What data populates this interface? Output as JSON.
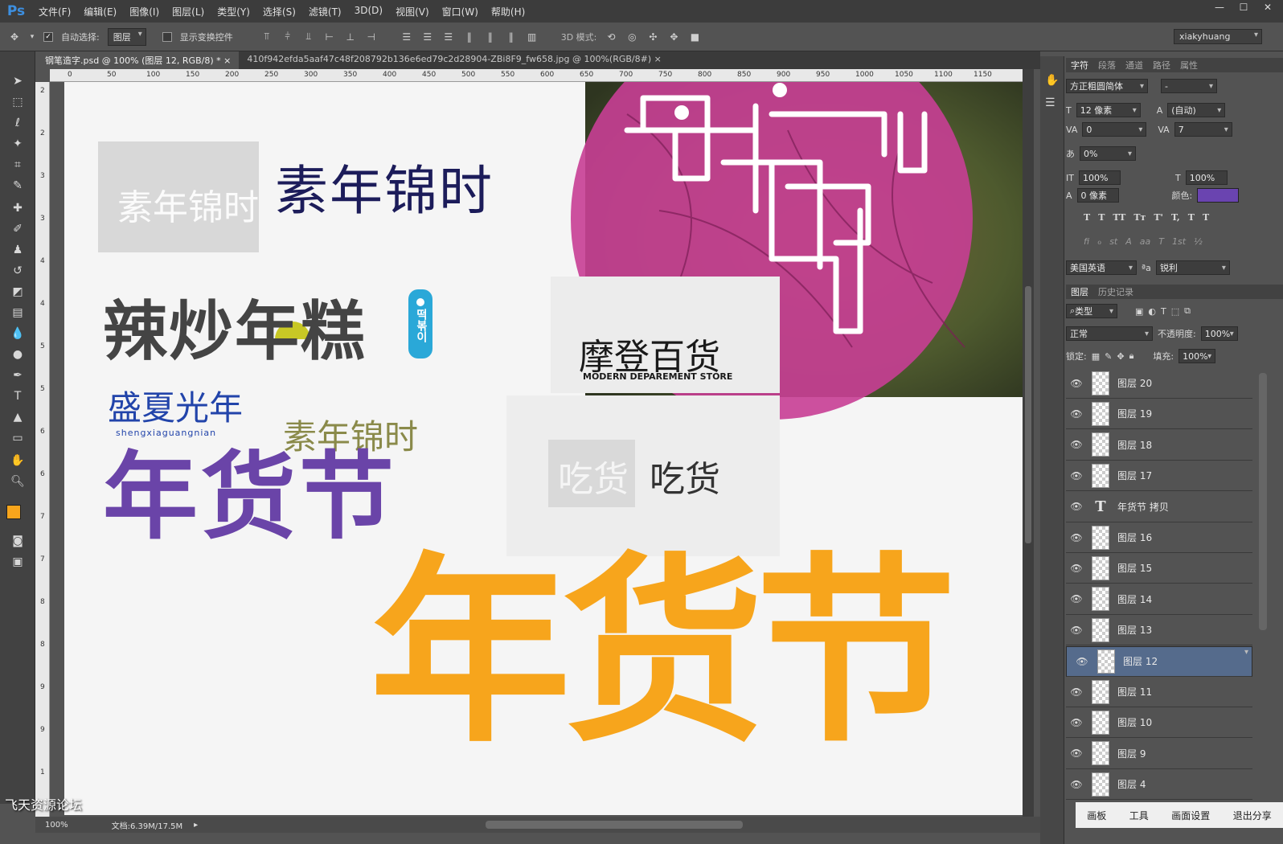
{
  "app": {
    "logo": "Ps"
  },
  "menu": [
    "文件(F)",
    "编辑(E)",
    "图像(I)",
    "图层(L)",
    "类型(Y)",
    "选择(S)",
    "滤镜(T)",
    "3D(D)",
    "视图(V)",
    "窗口(W)",
    "帮助(H)"
  ],
  "options": {
    "auto_select_label": "自动选择:",
    "auto_select_value": "图层",
    "show_transform_label": "显示变换控件",
    "mode3d_label": "3D 模式:",
    "workspace": "xiakyhuang"
  },
  "tabs": [
    {
      "label": "钢笔造字.psd @ 100% (图层 12, RGB/8) *",
      "active": true
    },
    {
      "label": "410f942efda5aaf47c48f208792b136e6ed79c2d28904-ZBi8F9_fw658.jpg @ 100%(RGB/8#)",
      "active": false
    }
  ],
  "ruler_h": [
    "0",
    "50",
    "100",
    "150",
    "200",
    "250",
    "300",
    "350",
    "400",
    "450",
    "500",
    "550",
    "600",
    "650",
    "700",
    "750",
    "800",
    "850",
    "900",
    "950",
    "1000",
    "1050",
    "1100",
    "1150"
  ],
  "ruler_v": [
    "2",
    "2",
    "3",
    "3",
    "4",
    "4",
    "5",
    "5",
    "6",
    "6",
    "7",
    "7",
    "8",
    "8",
    "9",
    "9",
    "1"
  ],
  "canvas": {
    "t1": "素年锦时",
    "t2": "辣炒年糕",
    "t2_tag": "떡볶이",
    "t3": "盛夏光年",
    "t3_sub": "shengxiaguangnian",
    "t4": "年货节",
    "t5": "母亲节",
    "t6": "摩登百货",
    "t6_sub": "MODERN DEPAREMENT STORE",
    "t7": "素年锦时",
    "t8": "吃货",
    "t9": "年货节"
  },
  "status": {
    "zoom": "100%",
    "doc": "文档:6.39M/17.5M"
  },
  "character_panel": {
    "tabs": [
      "字符",
      "段落",
      "通道",
      "路径",
      "属性"
    ],
    "font": "方正粗圆简体",
    "style": "-",
    "size": "12 像素",
    "leading": "(自动)",
    "kerning": "0",
    "tracking": "7",
    "scale_pct": "0%",
    "vscale": "100%",
    "hscale": "100%",
    "baseline": "0 像素",
    "color_label": "颜色:",
    "color": "#6a44b0",
    "language": "美国英语",
    "aa_label": "ªa",
    "antialias": "锐利",
    "type_btns": [
      "T",
      "T",
      "TT",
      "Tт",
      "T'",
      "T,",
      "T",
      "T"
    ],
    "ot_btns": [
      "fi",
      "ℴ",
      "st",
      "A",
      "aa",
      "T",
      "1st",
      "½"
    ]
  },
  "layers_panel": {
    "tabs": [
      "图层",
      "历史记录"
    ],
    "filter": "类型",
    "blend": "正常",
    "opacity_label": "不透明度:",
    "opacity": "100%",
    "lock_label": "锁定:",
    "fill_label": "填充:",
    "fill": "100%",
    "layers": [
      {
        "name": "图层 20",
        "type": "raster",
        "selected": false
      },
      {
        "name": "图层 19",
        "type": "raster",
        "selected": false
      },
      {
        "name": "图层 18",
        "type": "raster",
        "selected": false
      },
      {
        "name": "图层 17",
        "type": "raster",
        "selected": false
      },
      {
        "name": "年货节 拷贝",
        "type": "text",
        "selected": false
      },
      {
        "name": "图层 16",
        "type": "raster",
        "selected": false
      },
      {
        "name": "图层 15",
        "type": "raster",
        "selected": false
      },
      {
        "name": "图层 14",
        "type": "raster",
        "selected": false
      },
      {
        "name": "图层 13",
        "type": "raster",
        "selected": false
      },
      {
        "name": "图层 12",
        "type": "raster",
        "selected": true
      },
      {
        "name": "图层 11",
        "type": "raster",
        "selected": false
      },
      {
        "name": "图层 10",
        "type": "raster",
        "selected": false
      },
      {
        "name": "图层 9",
        "type": "raster",
        "selected": false
      },
      {
        "name": "图层 4",
        "type": "raster",
        "selected": false
      }
    ]
  },
  "bottom_bar": [
    "画板",
    "工具",
    "画面设置",
    "退出分享"
  ],
  "watermark": "飞天资源论坛"
}
